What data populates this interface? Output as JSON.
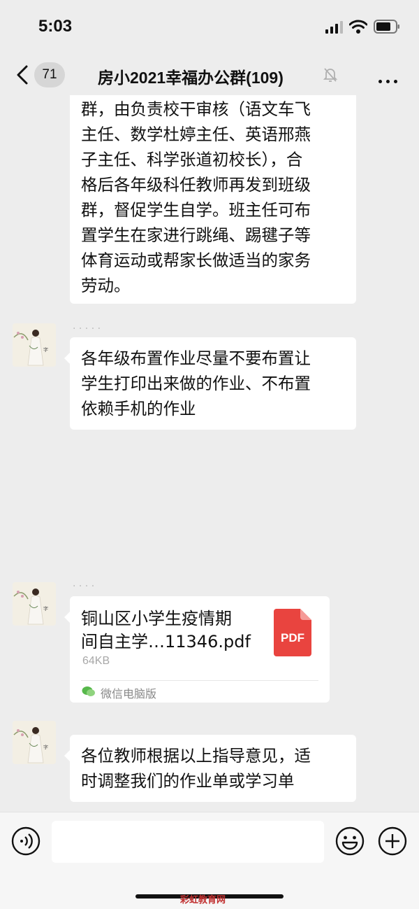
{
  "status": {
    "time": "5:03"
  },
  "nav": {
    "back_badge": "71",
    "title": "房小2021幸福办公群(109)"
  },
  "messages": [
    {
      "type": "text",
      "lines": [
        "群，由负责校干审核（语文车飞",
        "主任、数学杜婷主任、英语邢燕",
        "子主任、科学张道初校长），合",
        "格后各年级科任教师再发到班级",
        "群，督促学生自学。班主任可布",
        "置学生在家进行跳绳、踢毽子等",
        "体育运动或帮家长做适当的家务",
        "劳动。"
      ]
    },
    {
      "type": "text",
      "lines": [
        "各年级布置作业尽量不要布置让",
        "学生打印出来做的作业、不布置",
        "依赖手机的作业"
      ]
    },
    {
      "type": "file",
      "name_lines": [
        "铜山区小学生疫情期",
        "间自主学…11346.pdf"
      ],
      "size": "64KB",
      "file_type": "PDF",
      "source": "微信电脑版",
      "accent": "#e9443f"
    },
    {
      "type": "text",
      "lines": [
        "各位教师根据以上指导意见，适",
        "时调整我们的作业单或学习单"
      ]
    }
  ],
  "footer": {
    "watermark": "彩虹教育网"
  }
}
